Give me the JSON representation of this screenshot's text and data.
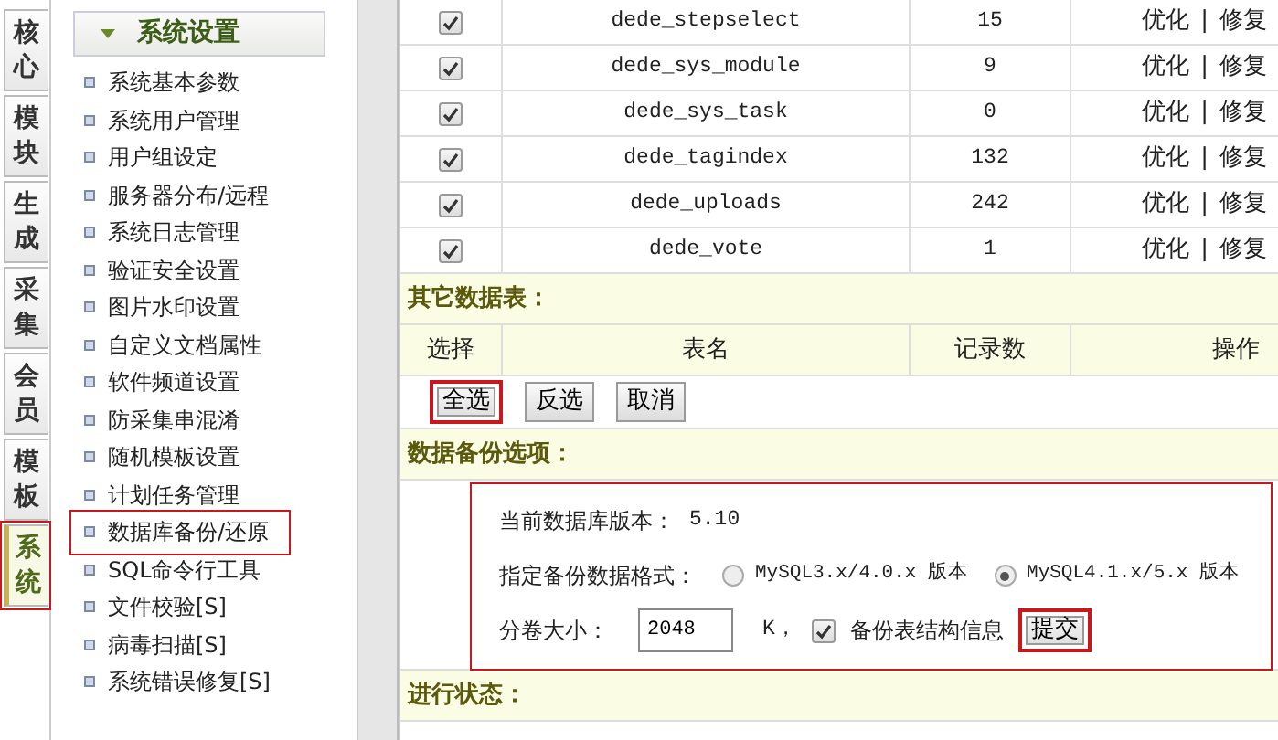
{
  "side_tabs": [
    {
      "label": "核心",
      "selected": false,
      "highlighted": false
    },
    {
      "label": "模块",
      "selected": false,
      "highlighted": false
    },
    {
      "label": "生成",
      "selected": false,
      "highlighted": false
    },
    {
      "label": "采集",
      "selected": false,
      "highlighted": false
    },
    {
      "label": "会员",
      "selected": false,
      "highlighted": false
    },
    {
      "label": "模板",
      "selected": false,
      "highlighted": false
    },
    {
      "label": "系统",
      "selected": true,
      "highlighted": true
    }
  ],
  "sidebar": {
    "title": "系统设置",
    "items": [
      {
        "label": "系统基本参数",
        "highlighted": false
      },
      {
        "label": "系统用户管理",
        "highlighted": false
      },
      {
        "label": "用户组设定",
        "highlighted": false
      },
      {
        "label": "服务器分布/远程",
        "highlighted": false
      },
      {
        "label": "系统日志管理",
        "highlighted": false
      },
      {
        "label": "验证安全设置",
        "highlighted": false
      },
      {
        "label": "图片水印设置",
        "highlighted": false
      },
      {
        "label": "自定义文档属性",
        "highlighted": false
      },
      {
        "label": "软件频道设置",
        "highlighted": false
      },
      {
        "label": "防采集串混淆",
        "highlighted": false
      },
      {
        "label": "随机模板设置",
        "highlighted": false
      },
      {
        "label": "计划任务管理",
        "highlighted": false
      },
      {
        "label": "数据库备份/还原",
        "highlighted": true
      },
      {
        "label": "SQL命令行工具",
        "highlighted": false
      },
      {
        "label": "文件校验[S]",
        "highlighted": false
      },
      {
        "label": "病毒扫描[S]",
        "highlighted": false
      },
      {
        "label": "系统错误修复[S]",
        "highlighted": false
      }
    ]
  },
  "table": {
    "rows": [
      {
        "checked": true,
        "name": "dede_stepselect",
        "count": "15",
        "optimize": "优化",
        "sep": "|",
        "repair": "修复"
      },
      {
        "checked": true,
        "name": "dede_sys_module",
        "count": "9",
        "optimize": "优化",
        "sep": "|",
        "repair": "修复"
      },
      {
        "checked": true,
        "name": "dede_sys_task",
        "count": "0",
        "optimize": "优化",
        "sep": "|",
        "repair": "修复"
      },
      {
        "checked": true,
        "name": "dede_tagindex",
        "count": "132",
        "optimize": "优化",
        "sep": "|",
        "repair": "修复"
      },
      {
        "checked": true,
        "name": "dede_uploads",
        "count": "242",
        "optimize": "优化",
        "sep": "|",
        "repair": "修复"
      },
      {
        "checked": true,
        "name": "dede_vote",
        "count": "1",
        "optimize": "优化",
        "sep": "|",
        "repair": "修复"
      }
    ]
  },
  "other_tables": {
    "title": "其它数据表：",
    "columns": [
      "选择",
      "表名",
      "记录数",
      "操作"
    ],
    "buttons": [
      {
        "label": "全选",
        "highlighted": true
      },
      {
        "label": "反选",
        "highlighted": false
      },
      {
        "label": "取消",
        "highlighted": false
      }
    ]
  },
  "backup_options": {
    "title": "数据备份选项：",
    "highlighted": true,
    "version_label": "当前数据库版本：",
    "version": "5.10",
    "format_label": "指定备份数据格式：",
    "formats": [
      {
        "label": "MySQL3.x/4.0.x 版本",
        "selected": false
      },
      {
        "label": "MySQL4.1.x/5.x 版本",
        "selected": true
      }
    ],
    "size_label": "分卷大小：",
    "size_value": "2048",
    "size_unit": "K，",
    "structure": {
      "label": "备份表结构信息",
      "checked": true
    },
    "submit": {
      "label": "提交",
      "highlighted": true
    }
  },
  "status_section": {
    "title": "进行状态："
  }
}
